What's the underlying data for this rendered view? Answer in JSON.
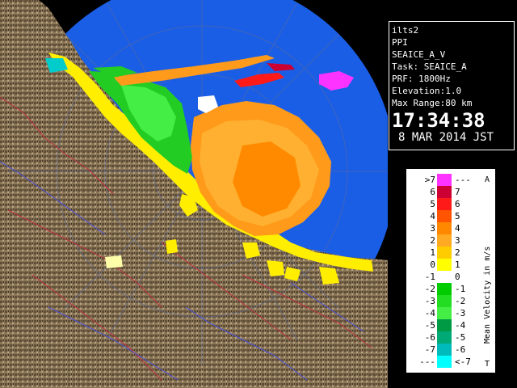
{
  "info": {
    "station": "ilts2",
    "product": "PPI",
    "product_id": "SEAICE_A_V",
    "task": "Task: SEAICE_A",
    "prf": "PRF: 1800Hz",
    "elevation": "Elevation:1.0",
    "max_range": "Max Range:80 km",
    "time": "17:34:38",
    "date": "8 MAR 2014 JST"
  },
  "legend": {
    "title": "Mean Velocity in m/s",
    "top_marker": "A",
    "bottom_marker": "T",
    "rows": [
      {
        "left": ">7",
        "right": "---",
        "color": "#ff33ff"
      },
      {
        "left": "6",
        "right": "7",
        "color": "#cc0033"
      },
      {
        "left": "5",
        "right": "6",
        "color": "#ff1a1a"
      },
      {
        "left": "4",
        "right": "5",
        "color": "#ff5500"
      },
      {
        "left": "3",
        "right": "4",
        "color": "#ff8800"
      },
      {
        "left": "2",
        "right": "3",
        "color": "#ffaa22"
      },
      {
        "left": "1",
        "right": "2",
        "color": "#ffcc00"
      },
      {
        "left": "0",
        "right": "1",
        "color": "#ffff00"
      },
      {
        "left": "-1",
        "right": "0",
        "color": "#ffffff"
      },
      {
        "left": "-2",
        "right": "-1",
        "color": "#00cc00"
      },
      {
        "left": "-3",
        "right": "-2",
        "color": "#22dd22"
      },
      {
        "left": "-4",
        "right": "-3",
        "color": "#44ee44"
      },
      {
        "left": "-5",
        "right": "-4",
        "color": "#009944"
      },
      {
        "left": "-6",
        "right": "-5",
        "color": "#00aa77"
      },
      {
        "left": "-7",
        "right": "-6",
        "color": "#00bbbb"
      },
      {
        "left": "---",
        "right": "<-7",
        "color": "#00ffff"
      }
    ]
  },
  "colors": {
    "range_circle": "#1a5ee6",
    "terrain": "#8a7556",
    "coast_echo": "#ffee00",
    "approach_echo": "#ff9900"
  }
}
